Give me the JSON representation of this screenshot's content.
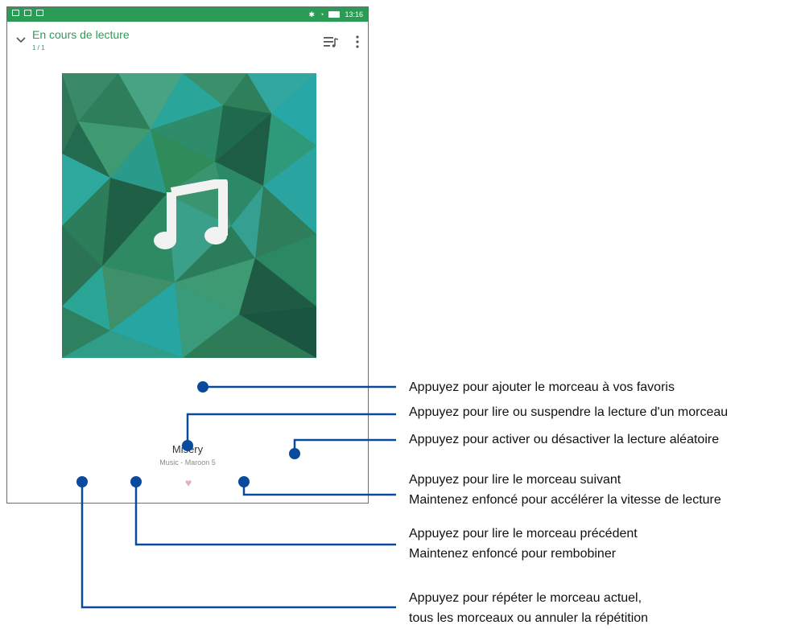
{
  "status_bar": {
    "time": "13:16"
  },
  "header": {
    "title": "En cours de lecture",
    "count": "1 / 1"
  },
  "now_playing": {
    "song_title": "Misery",
    "song_subtitle": "Music - Maroon 5"
  },
  "icons": [
    "chevron-down-icon",
    "queue-music-icon",
    "more-vert-icon",
    "music-note-icon",
    "heart-icon"
  ],
  "colors": {
    "accent": "#2b9c55",
    "callout": "#0a4a9c",
    "heart": "#e0b1b6"
  },
  "callouts": [
    {
      "lines": [
        "Appuyez pour ajouter le morceau à vos favoris"
      ]
    },
    {
      "lines": [
        "Appuyez pour lire ou suspendre la lecture d'un morceau"
      ]
    },
    {
      "lines": [
        "Appuyez pour activer ou désactiver la lecture aléatoire"
      ]
    },
    {
      "lines": [
        "Appuyez pour lire le morceau suivant",
        "Maintenez enfoncé pour accélérer la vitesse de lecture"
      ]
    },
    {
      "lines": [
        "Appuyez pour lire le morceau précédent",
        "Maintenez enfoncé pour rembobiner"
      ]
    },
    {
      "lines": [
        "Appuyez pour répéter le morceau actuel,",
        "tous les morceaux ou annuler la répétition"
      ]
    }
  ]
}
